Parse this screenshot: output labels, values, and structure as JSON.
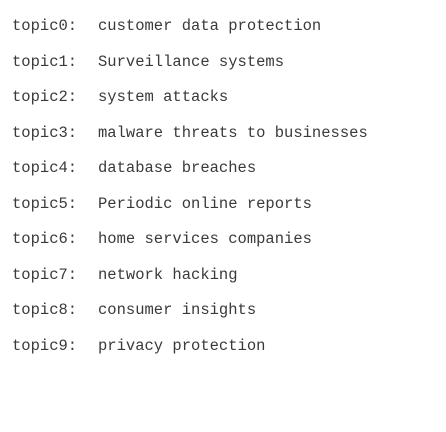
{
  "topics": [
    {
      "key": "topic0:",
      "value": "customer data protection"
    },
    {
      "key": "topic1:",
      "value": "Surveillance systems"
    },
    {
      "key": "topic2:",
      "value": "system attacks"
    },
    {
      "key": "topic3:",
      "value": "malware threats to businesses"
    },
    {
      "key": "topic4:",
      "value": "database breaches"
    },
    {
      "key": "topic5:",
      "value": "Periodic online reports"
    },
    {
      "key": "topic6:",
      "value": "home services companies"
    },
    {
      "key": "topic7:",
      "value": "network hacking"
    },
    {
      "key": "topic8:",
      "value": "consumer insights"
    },
    {
      "key": "topic9:",
      "value": "privacy protection"
    }
  ]
}
